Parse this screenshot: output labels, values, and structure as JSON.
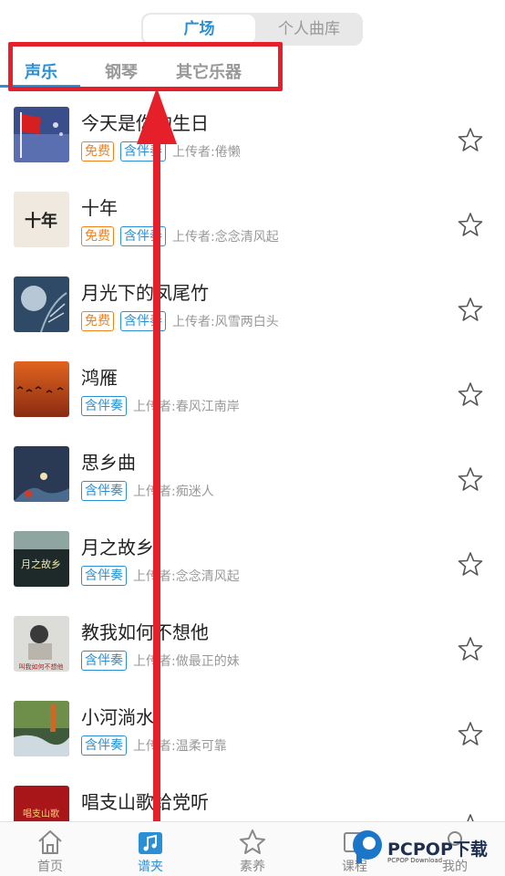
{
  "top_segment": {
    "active": "广场",
    "inactive": "个人曲库"
  },
  "categories": [
    "声乐",
    "钢琴",
    "其它乐器"
  ],
  "songs": [
    {
      "title": "今天是你的生日",
      "tags": [
        "免费",
        "含伴奏"
      ],
      "uploader": "上传者:倦懒"
    },
    {
      "title": "十年",
      "tags": [
        "免费",
        "含伴奏"
      ],
      "uploader": "上传者:念念清风起"
    },
    {
      "title": "月光下的凤尾竹",
      "tags": [
        "免费",
        "含伴奏"
      ],
      "uploader": "上传者:风雪两白头"
    },
    {
      "title": "鸿雁",
      "tags": [
        "含伴奏"
      ],
      "uploader": "上传者:春风江南岸"
    },
    {
      "title": "思乡曲",
      "tags": [
        "含伴奏"
      ],
      "uploader": "上传者:痴迷人"
    },
    {
      "title": "月之故乡",
      "tags": [
        "含伴奏"
      ],
      "uploader": "上传者:念念清风起"
    },
    {
      "title": "教我如何不想他",
      "tags": [
        "含伴奏"
      ],
      "uploader": "上传者:做最正的妹"
    },
    {
      "title": "小河淌水",
      "tags": [
        "含伴奏"
      ],
      "uploader": "上传者:温柔可靠"
    },
    {
      "title": "唱支山歌给党听",
      "tags": [],
      "uploader": ""
    }
  ],
  "thumb_text": {
    "shinian": "十年",
    "jiaowo": "叫我如何不想他",
    "yuezhi": "月之故乡",
    "changzhi": "唱支山歌"
  },
  "tabs": [
    "首页",
    "谱夹",
    "素养",
    "课程",
    "我的"
  ],
  "logo": {
    "text": "PCPOP下载",
    "sub": "PCPOP Download"
  },
  "colors": {
    "accent": "#2a8fd4",
    "free": "#f0821e",
    "annotation_red": "#e5202a"
  }
}
